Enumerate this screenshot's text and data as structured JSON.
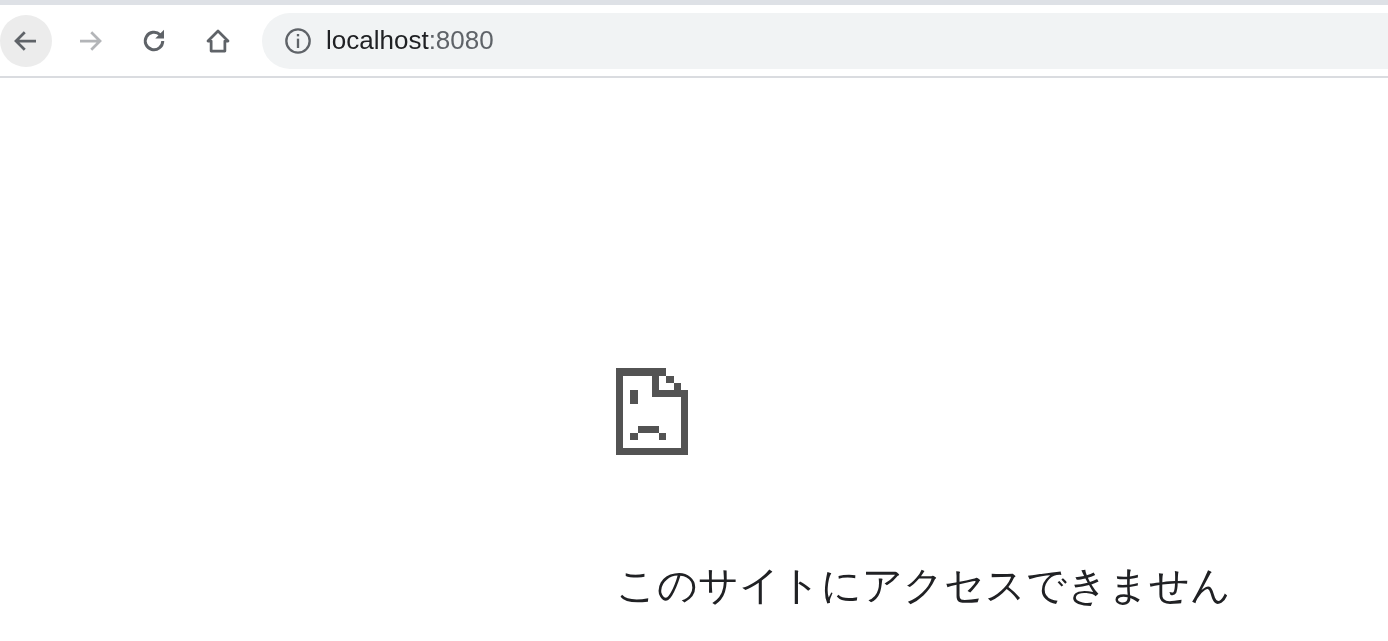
{
  "toolbar": {
    "buttons": [
      {
        "kind": "back",
        "disabled": false,
        "hovered": true
      },
      {
        "kind": "forward",
        "disabled": true,
        "hovered": false
      },
      {
        "kind": "reload",
        "disabled": false,
        "hovered": false
      },
      {
        "kind": "home",
        "disabled": false,
        "hovered": false
      }
    ]
  },
  "address_bar": {
    "host": "localhost",
    "port": ":8080"
  },
  "error": {
    "title": "このサイトにアクセスできません"
  }
}
